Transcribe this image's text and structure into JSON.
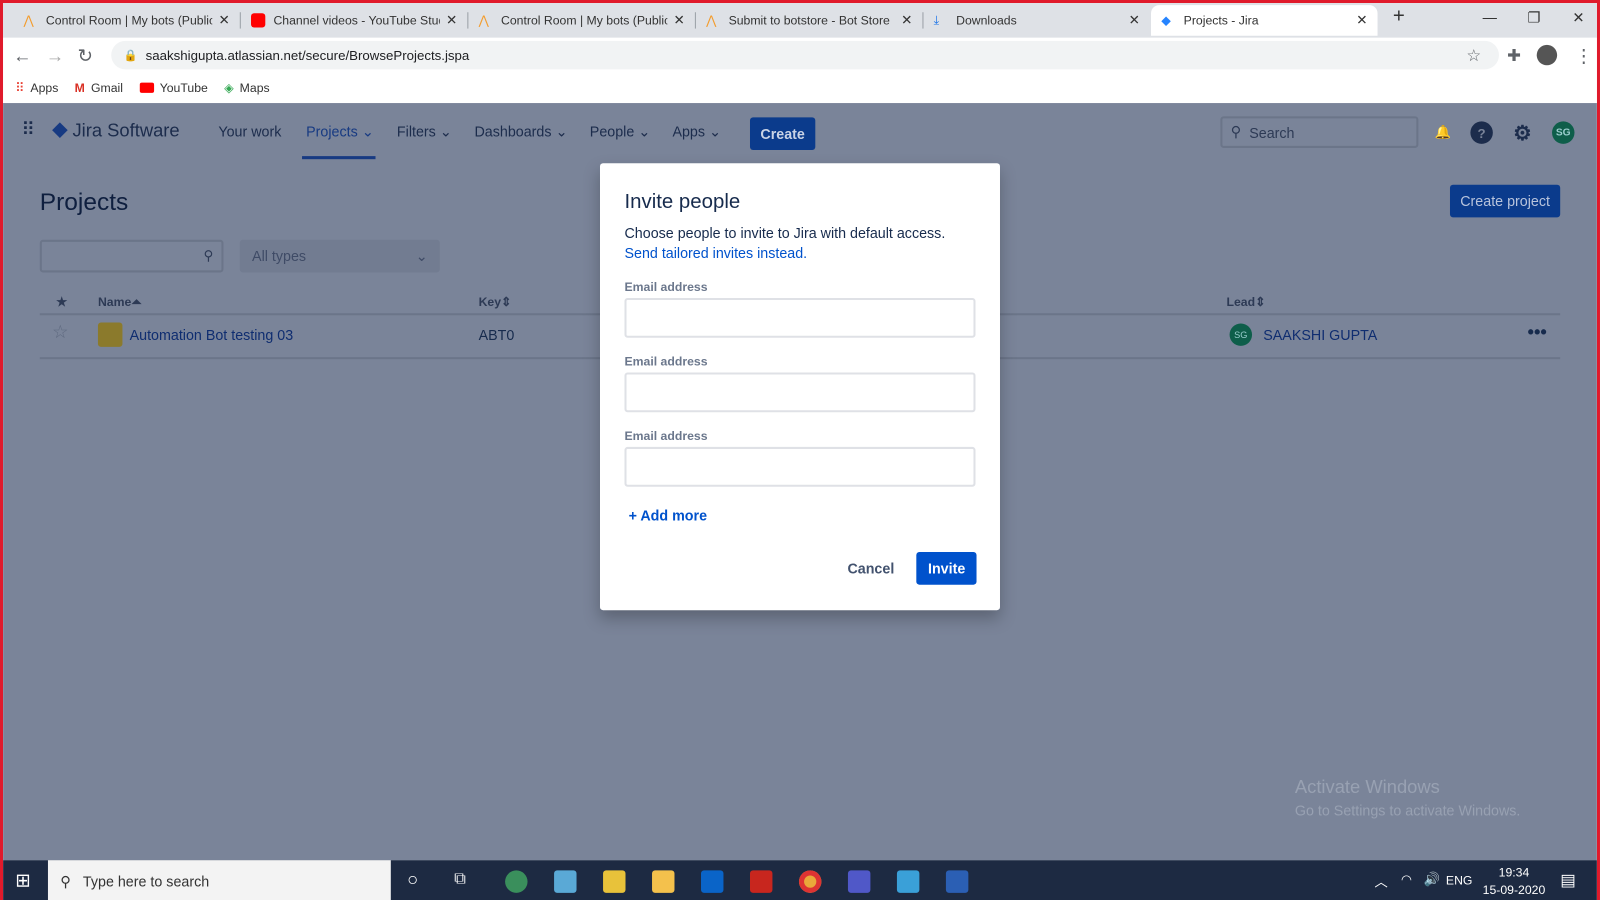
{
  "browser": {
    "tabs": [
      {
        "title": "Control Room | My bots (Public",
        "active": false
      },
      {
        "title": "Channel videos - YouTube Stud",
        "active": false
      },
      {
        "title": "Control Room | My bots (Public",
        "active": false
      },
      {
        "title": "Submit to botstore - Bot Store",
        "active": false
      },
      {
        "title": "Downloads",
        "active": false
      },
      {
        "title": "Projects - Jira",
        "active": true
      }
    ],
    "url": "saakshigupta.atlassian.net/secure/BrowseProjects.jspa",
    "bookmarks": [
      "Apps",
      "Gmail",
      "YouTube",
      "Maps"
    ]
  },
  "jira": {
    "product": "Jira Software",
    "nav": [
      "Your work",
      "Projects",
      "Filters",
      "Dashboards",
      "People",
      "Apps"
    ],
    "create": "Create",
    "search_placeholder": "Search",
    "avatar": "SG",
    "help": "?"
  },
  "projects": {
    "title": "Projects",
    "create_project": "Create project",
    "type_filter": "All types",
    "columns": {
      "name": "Name",
      "key": "Key",
      "lead": "Lead"
    },
    "rows": [
      {
        "name": "Automation Bot testing 03",
        "key": "ABT0",
        "lead": "SAAKSHI GUPTA",
        "lead_initials": "SG"
      }
    ]
  },
  "modal": {
    "title": "Invite people",
    "desc": "Choose people to invite to Jira with default access. ",
    "desc_link": "Send tailored invites instead.",
    "email_label": "Email address",
    "add_more": "+ Add more",
    "cancel": "Cancel",
    "invite": "Invite"
  },
  "watermark": {
    "title": "Activate Windows",
    "sub": "Go to Settings to activate Windows."
  },
  "taskbar": {
    "search": "Type here to search",
    "lang": "ENG",
    "time": "19:34",
    "date": "15-09-2020"
  }
}
